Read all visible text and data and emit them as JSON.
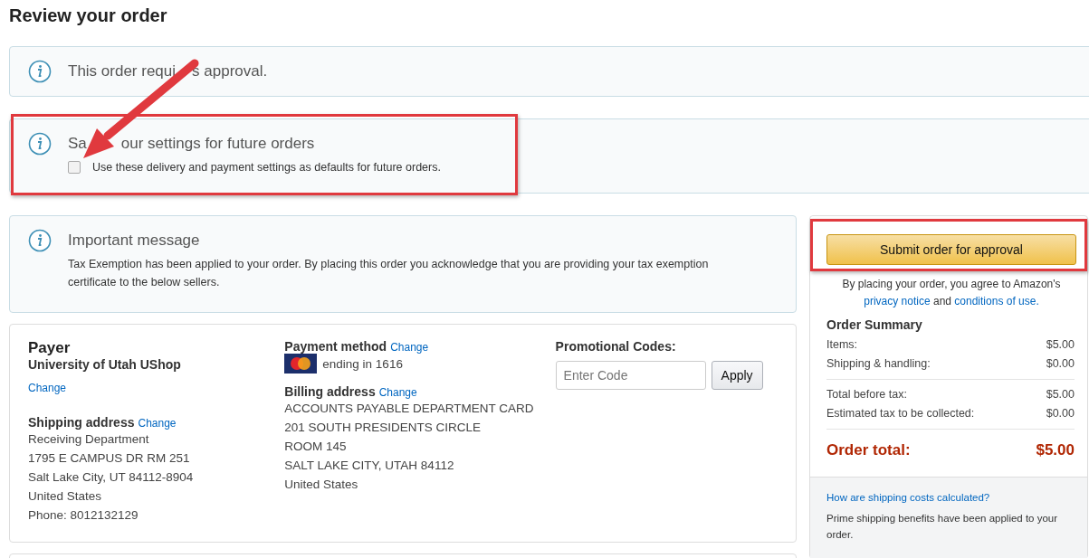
{
  "page_title": "Review your order",
  "approval_notice": {
    "text_parts": [
      "This order requi",
      "s approval."
    ]
  },
  "settings_notice": {
    "title_parts": [
      "Sa",
      "our settings for future orders"
    ],
    "checkbox": {
      "label": "Use these delivery and payment settings as defaults for future orders.",
      "checked": false
    }
  },
  "important_message": {
    "title": "Important message",
    "text": "Tax Exemption has been applied to your order. By placing this order you acknowledge that you are providing your tax exemption certificate to the below sellers."
  },
  "payer": {
    "heading": "Payer",
    "name": "University of Utah UShop",
    "change": "Change"
  },
  "shipping_address": {
    "heading": "Shipping address",
    "change": "Change",
    "lines": [
      "Receiving Department",
      "1795 E CAMPUS DR RM 251",
      "Salt Lake City, UT 84112-8904",
      "United States",
      "Phone: 8012132129"
    ]
  },
  "payment_method": {
    "heading": "Payment method",
    "change": "Change",
    "card": "ending in 1616"
  },
  "billing_address": {
    "heading": "Billing address",
    "change": "Change",
    "lines": [
      "ACCOUNTS PAYABLE DEPARTMENT CARD",
      "201 SOUTH PRESIDENTS CIRCLE",
      "ROOM 145",
      "SALT LAKE CITY, UTAH 84112",
      "United States"
    ]
  },
  "promo": {
    "heading": "Promotional Codes:",
    "placeholder": "Enter Code",
    "button": "Apply"
  },
  "sidebar": {
    "submit_button": "Submit order for approval",
    "agreement_text": "By placing your order, you agree to Amazon's",
    "privacy_link": "privacy notice",
    "and_text": "and",
    "conditions_link": "conditions of use.",
    "summary_title": "Order Summary",
    "summary_groups": [
      [
        {
          "label": "Items:",
          "value": "$5.00"
        },
        {
          "label": "Shipping & handling:",
          "value": "$0.00"
        }
      ],
      [
        {
          "label": "Total before tax:",
          "value": "$5.00"
        },
        {
          "label": "Estimated tax to be collected:",
          "value": "$0.00"
        }
      ]
    ],
    "total_label": "Order total:",
    "total_value": "$5.00",
    "shipping_link": "How are shipping costs calculated?",
    "prime_note": "Prime shipping benefits have been applied to your order."
  }
}
